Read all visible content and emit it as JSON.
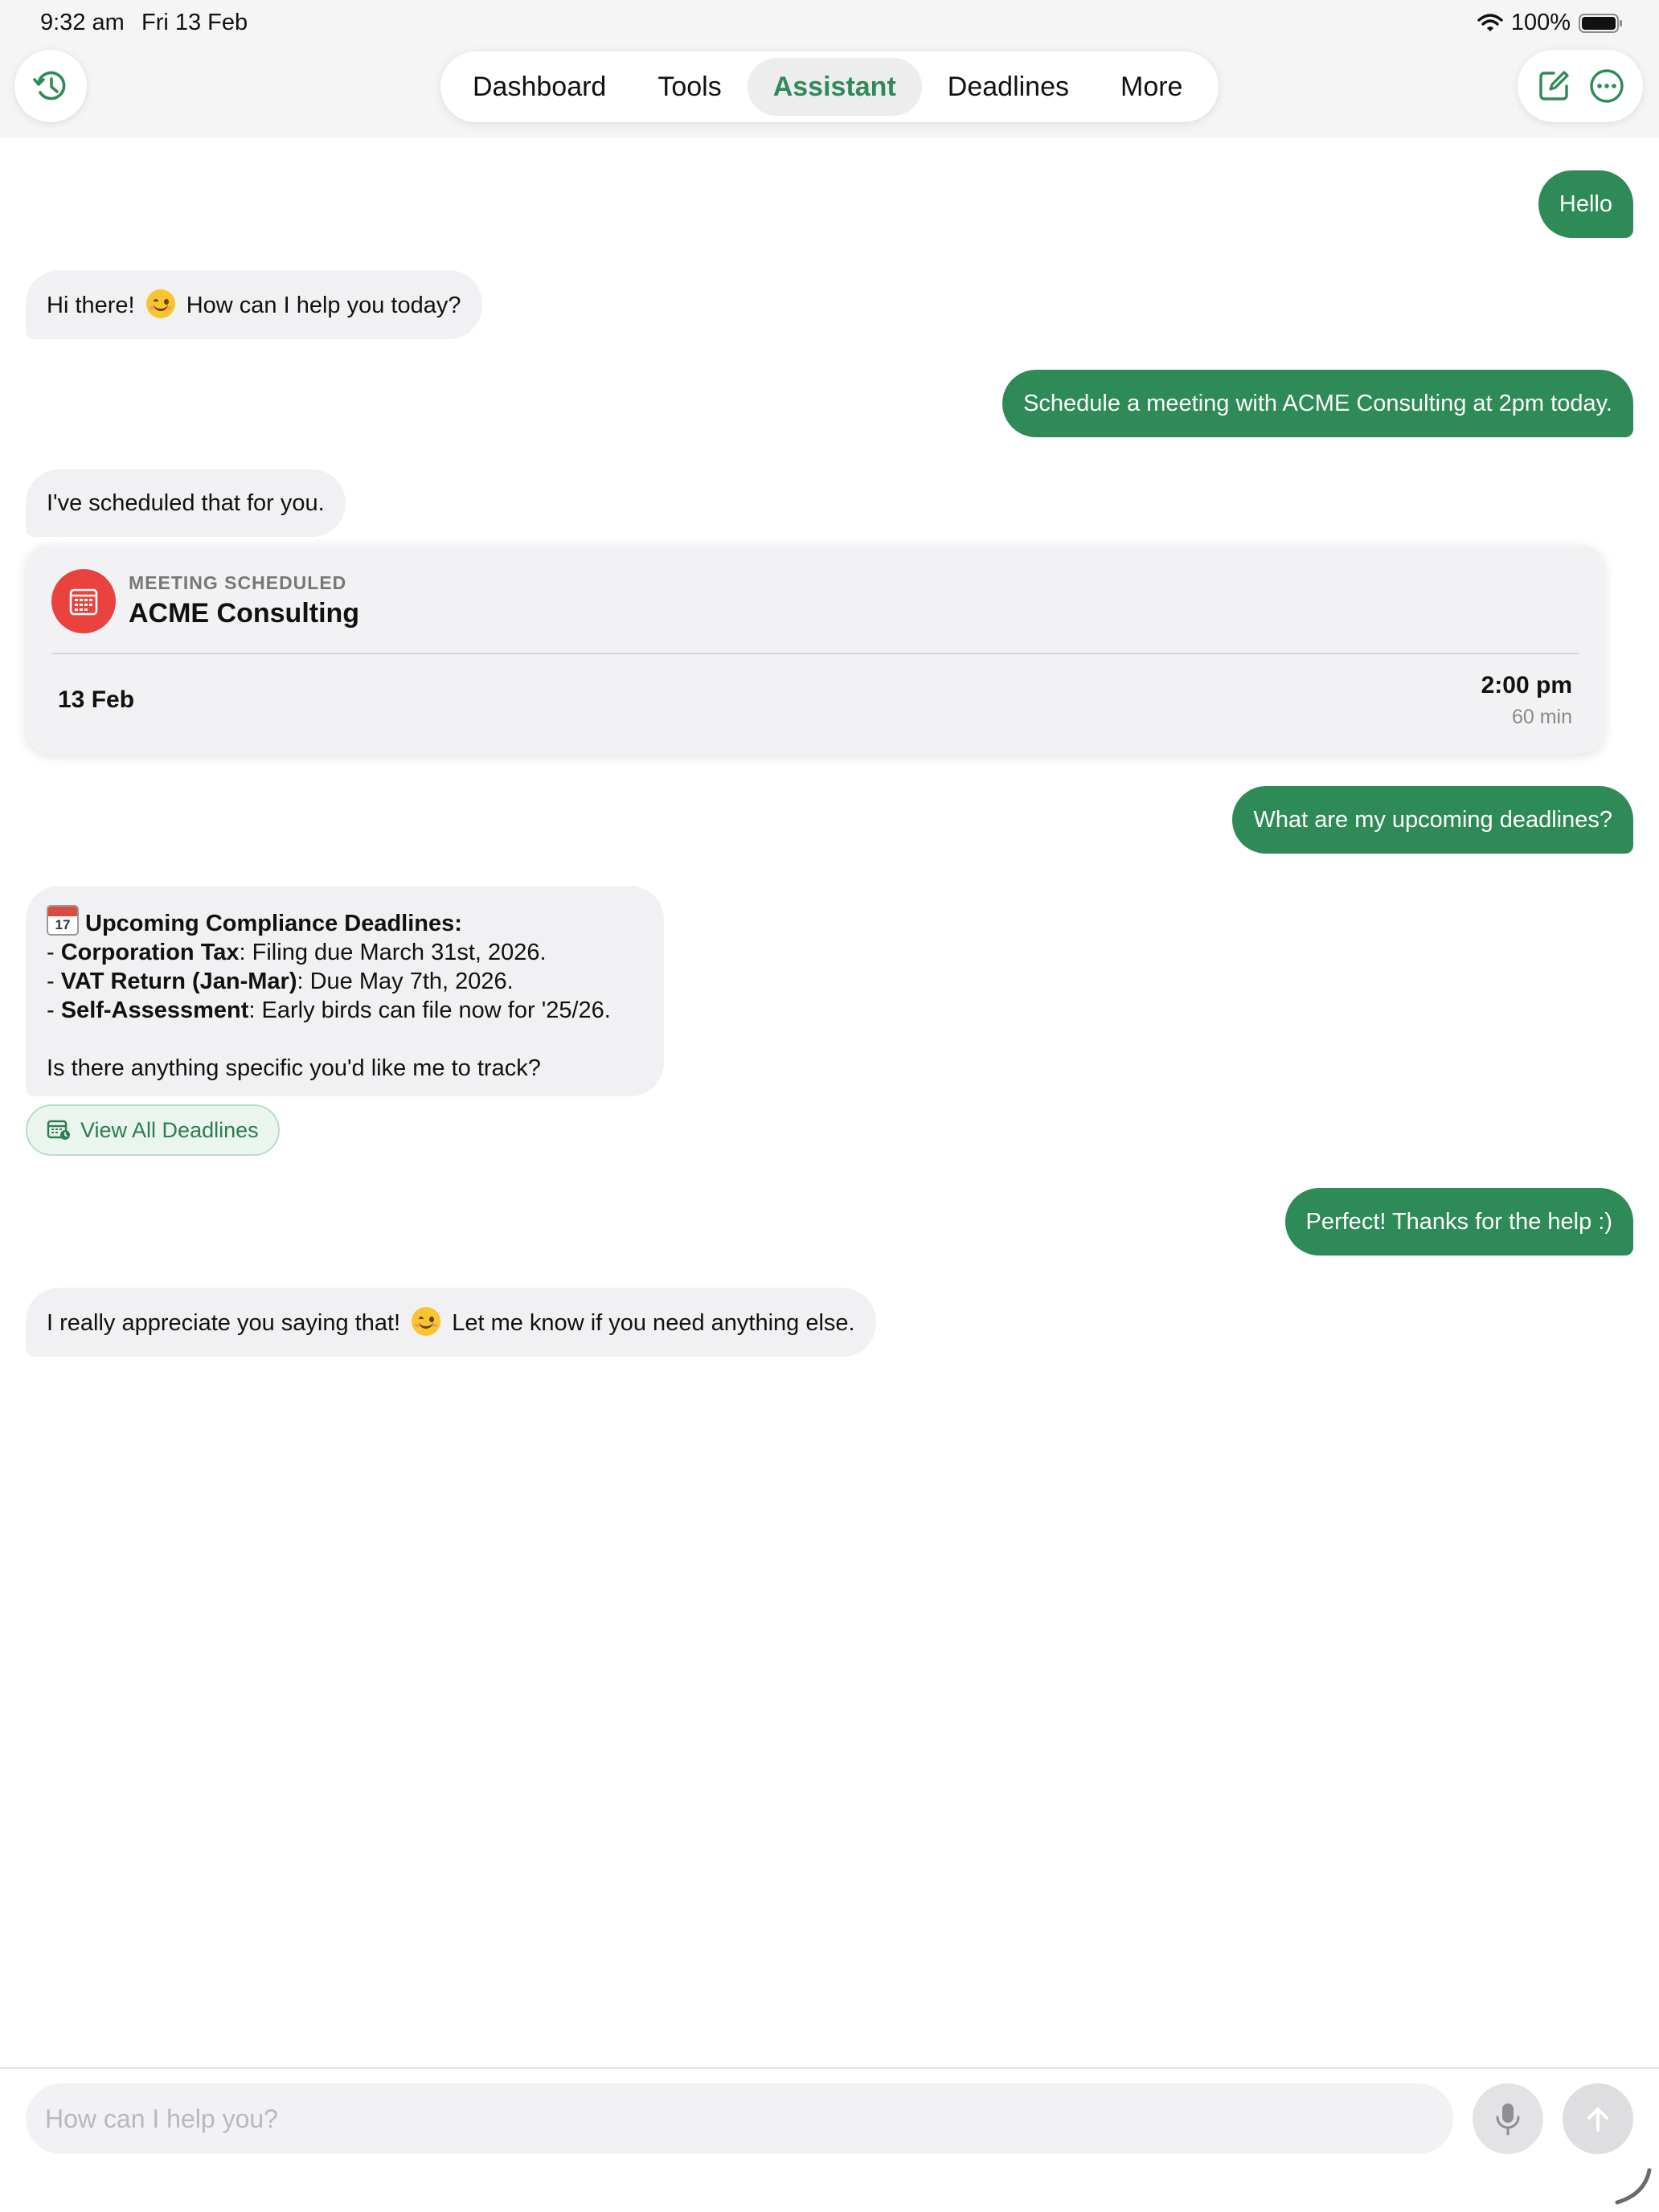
{
  "status_bar": {
    "time": "9:32 am",
    "date": "Fri 13 Feb",
    "battery": "100%"
  },
  "nav": {
    "tabs": [
      {
        "label": "Dashboard",
        "active": false
      },
      {
        "label": "Tools",
        "active": false
      },
      {
        "label": "Assistant",
        "active": true
      },
      {
        "label": "Deadlines",
        "active": false
      },
      {
        "label": "More",
        "active": false
      }
    ],
    "history_icon": "clock-history-icon",
    "compose_icon": "compose-icon",
    "more_icon": "ellipsis-circle-icon"
  },
  "messages": [
    {
      "role": "user",
      "text": "Hello"
    },
    {
      "role": "assistant",
      "before": "Hi there!",
      "emoji": "smiling-face-icon",
      "after": "How can I help you today?"
    },
    {
      "role": "user",
      "text": "Schedule a meeting with ACME Consulting at 2pm today."
    },
    {
      "role": "assistant",
      "text": "I've scheduled that for you."
    },
    {
      "role": "user",
      "text": "What are my upcoming deadlines?"
    },
    {
      "role": "user",
      "text": "Perfect! Thanks for the help :)"
    },
    {
      "role": "assistant",
      "before": "I really appreciate you saying that!",
      "emoji": "smiling-face-icon",
      "after": "Let me know if you need anything else."
    }
  ],
  "meeting_card": {
    "kicker": "MEETING SCHEDULED",
    "title": "ACME Consulting",
    "date": "13 Feb",
    "time": "2:00 pm",
    "duration": "60 min"
  },
  "deadlines_message": {
    "calendar_day": "17",
    "heading": "Upcoming Compliance Deadlines:",
    "items": [
      {
        "name": "Corporation Tax",
        "detail": ": Filing due March 31st, 2026."
      },
      {
        "name": "VAT Return (Jan-Mar)",
        "detail": ": Due May 7th, 2026."
      },
      {
        "name": "Self-Assessment",
        "detail": ": Early birds can file now for '25/26."
      }
    ],
    "question": "Is there anything specific you'd like me to track?",
    "action_label": "View All Deadlines"
  },
  "composer": {
    "placeholder": "How can I help you?"
  },
  "colors": {
    "accent": "#2e8b57",
    "bot_bubble": "#f1f1f3",
    "calendar_red": "#e9423f"
  }
}
